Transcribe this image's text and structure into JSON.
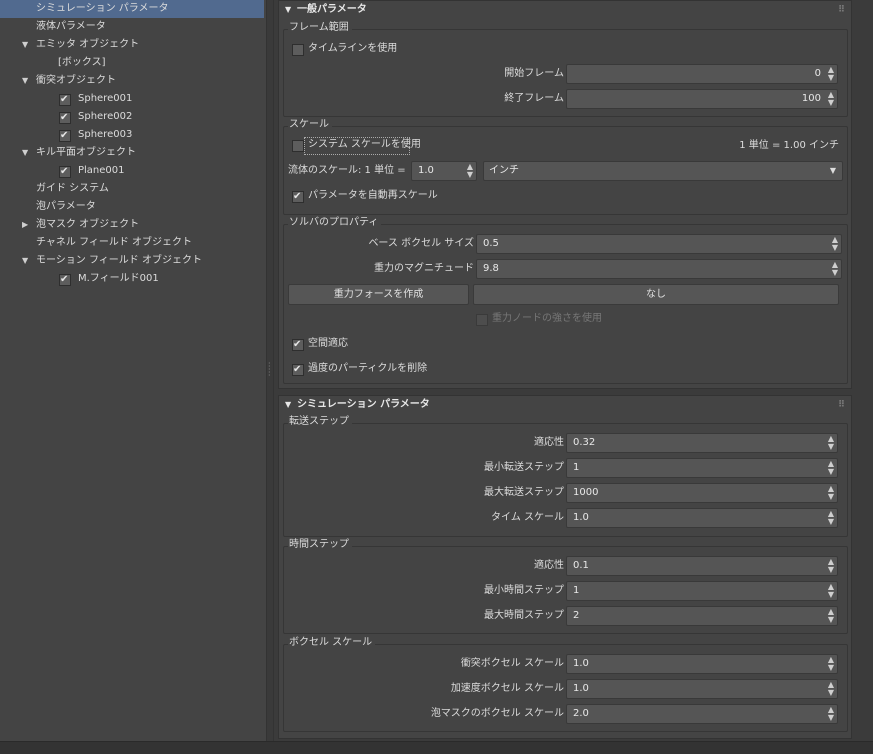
{
  "tree": {
    "sim_params": "シミュレーション パラメータ",
    "fluid_params": "液体パラメータ",
    "emitter_objects": "エミッタ オブジェクト",
    "box": "[ボックス]",
    "collision_objects": "衝突オブジェクト",
    "sphere001": "Sphere001",
    "sphere002": "Sphere002",
    "sphere003": "Sphere003",
    "kill_plane_objects": "キル平面オブジェクト",
    "plane001": "Plane001",
    "guide_system": "ガイド システム",
    "foam_params": "泡パラメータ",
    "foam_mask_objects": "泡マスク オブジェクト",
    "channel_field_objects": "チャネル フィールド オブジェクト",
    "motion_field_objects": "モーション フィールド オブジェクト",
    "mfield001": "M.フィールド001"
  },
  "general": {
    "title": "一般パラメータ",
    "frame_range": {
      "label": "フレーム範囲",
      "use_timeline": "タイムラインを使用",
      "start_frame_label": "開始フレーム",
      "start_frame": "0",
      "end_frame_label": "終了フレーム",
      "end_frame": "100"
    },
    "scale": {
      "label": "スケール",
      "use_system_scale": "システム スケールを使用",
      "unit_readout": "1 単位 = 1.00 インチ",
      "fluid_scale_label": "流体のスケール: 1 単位 =",
      "fluid_scale": "1.0",
      "unit": "インチ",
      "auto_rescale": "パラメータを自動再スケール"
    },
    "solver": {
      "label": "ソルバのプロパティ",
      "base_voxel_label": "ベース ボクセル サイズ",
      "base_voxel": "0.5",
      "gravity_label": "重力のマグニチュード",
      "gravity": "9.8",
      "create_gravity_button": "重力フォースを作成",
      "gravity_node": "なし",
      "use_gravity_node_strength": "重力ノードの強さを使用",
      "spatial_adapt": "空間適応",
      "remove_excess": "過度のパーティクルを削除"
    }
  },
  "simulation": {
    "title": "シミュレーション パラメータ",
    "transport": {
      "label": "転送ステップ",
      "adaptivity_label": "適応性",
      "adaptivity": "0.32",
      "min_label": "最小転送ステップ",
      "min": "1",
      "max_label": "最大転送ステップ",
      "max": "1000",
      "time_scale_label": "タイム スケール",
      "time_scale": "1.0"
    },
    "time": {
      "label": "時間ステップ",
      "adaptivity_label": "適応性",
      "adaptivity": "0.1",
      "min_label": "最小時間ステップ",
      "min": "1",
      "max_label": "最大時間ステップ",
      "max": "2"
    },
    "voxel_scale": {
      "label": "ボクセル スケール",
      "collision_label": "衝突ボクセル スケール",
      "collision": "1.0",
      "acceleration_label": "加速度ボクセル スケール",
      "acceleration": "1.0",
      "foam_mask_label": "泡マスクのボクセル スケール",
      "foam_mask": "2.0"
    }
  },
  "colors": {
    "selection": "#516a8f",
    "panel": "#444444",
    "field": "#555555"
  }
}
